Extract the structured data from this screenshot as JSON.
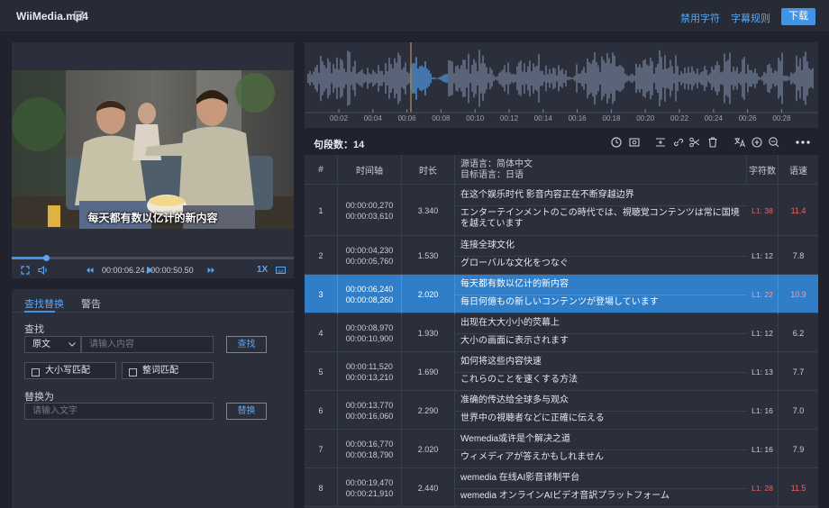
{
  "header": {
    "file_name": "WiiMedia.mp4",
    "disable_chars": "禁用字符",
    "subtitle_rules": "字幕规则",
    "download": "下载"
  },
  "player": {
    "current_subtitle": "每天都有数以亿计的新内容",
    "current_time": "00:00:06.24",
    "total_time": "00:00:50.50",
    "progress": 0.123,
    "speed": "1X"
  },
  "find_replace": {
    "tabs": [
      "查找替换",
      "警告"
    ],
    "find_label": "查找",
    "scope_select": "原文",
    "find_placeholder": "请输入内容",
    "find_button": "查找",
    "match_case": "大小写匹配",
    "whole_word": "整词匹配",
    "replace_label": "替换为",
    "replace_placeholder": "请输入文字",
    "replace_button": "替换"
  },
  "waveform": {
    "ticks": [
      "00:02",
      "00:04",
      "00:06",
      "00:08",
      "00:10",
      "00:12",
      "00:14",
      "00:16",
      "00:18",
      "00:20",
      "00:22",
      "00:24",
      "00:26",
      "00:28"
    ]
  },
  "toolbar": {
    "segment_count": "句段数：14"
  },
  "table": {
    "headers": {
      "index": "#",
      "timeline": "时间轴",
      "duration": "时长",
      "source_lang": "源语言：简体中文",
      "target_lang": "目标语言：日语",
      "char_count": "字符数",
      "speed": "语速"
    },
    "rows": [
      {
        "index": "1",
        "start": "00:00:00,270",
        "end": "00:00:03,610",
        "duration": "3.340",
        "source": "在这个娱乐时代 影音内容正在不断穿越边界",
        "target": "エンターテインメントのこの時代では、視聴覚コンテンツは常に国境を越えています",
        "chars": "L1: 38",
        "speed": "11.4",
        "warn": true
      },
      {
        "index": "2",
        "start": "00:00:04,230",
        "end": "00:00:05,760",
        "duration": "1.530",
        "source": "连接全球文化",
        "target": "グローバルな文化をつなぐ",
        "chars": "L1: 12",
        "speed": "7.8",
        "warn": false
      },
      {
        "index": "3",
        "start": "00:00:06,240",
        "end": "00:00:08,260",
        "duration": "2.020",
        "source": "每天都有数以亿计的新内容",
        "target": "毎日何億もの新しいコンテンツが登場しています",
        "chars": "L1: 22",
        "speed": "10.9",
        "warn": true
      },
      {
        "index": "4",
        "start": "00:00:08,970",
        "end": "00:00:10,900",
        "duration": "1.930",
        "source": "出现在大大小小的荧幕上",
        "target": "大小の画面に表示されます",
        "chars": "L1: 12",
        "speed": "6.2",
        "warn": false
      },
      {
        "index": "5",
        "start": "00:00:11,520",
        "end": "00:00:13,210",
        "duration": "1.690",
        "source": "如何将这些内容快速",
        "target": "これらのことを速くする方法",
        "chars": "L1: 13",
        "speed": "7.7",
        "warn": false
      },
      {
        "index": "6",
        "start": "00:00:13,770",
        "end": "00:00:16,060",
        "duration": "2.290",
        "source": "准确的传达给全球多与观众",
        "target": "世界中の視聴者などに正確に伝える",
        "chars": "L1: 16",
        "speed": "7.0",
        "warn": false
      },
      {
        "index": "7",
        "start": "00:00:16,770",
        "end": "00:00:18,790",
        "duration": "2.020",
        "source": "Wemedia或许是个解决之道",
        "target": "ウィメディアが答えかもしれません",
        "chars": "L1: 16",
        "speed": "7.9",
        "warn": false
      },
      {
        "index": "8",
        "start": "00:00:19,470",
        "end": "00:00:21,910",
        "duration": "2.440",
        "source": "wemedia 在线AI影音译制平台",
        "target": "wemedia オンラインAIビデオ音訳プラットフォーム",
        "chars": "L1: 28",
        "speed": "11.5",
        "warn": true
      }
    ]
  },
  "colors": {
    "accent": "#3f93e9",
    "selected_row": "#2f7ec7",
    "warning": "#f0605e"
  }
}
